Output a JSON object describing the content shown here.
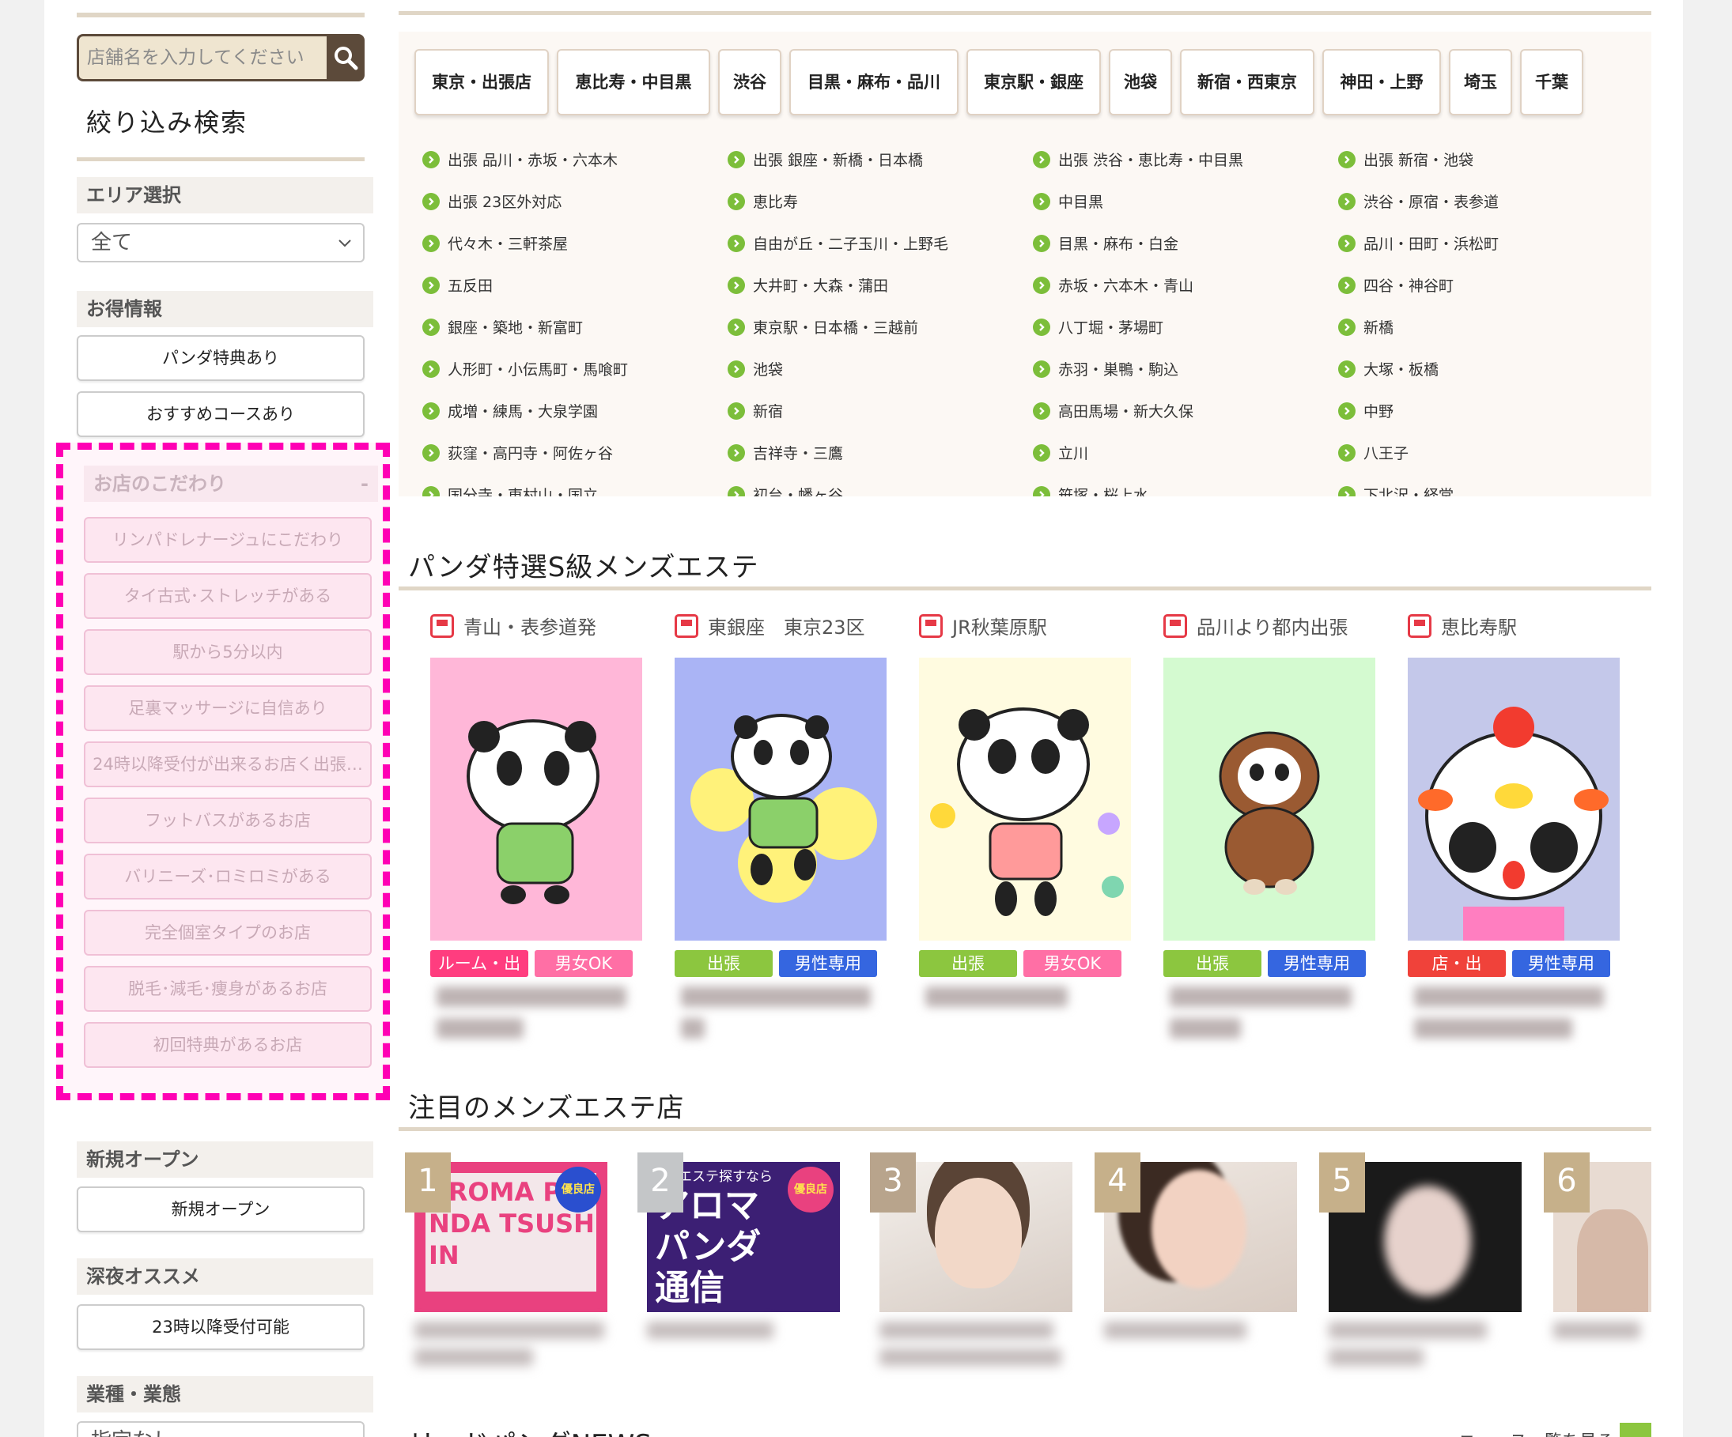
{
  "sidebar": {
    "search_placeholder": "店舗名を入力してください",
    "filter_title": "絞り込み検索",
    "area_head": "エリア選択",
    "area_selected": "全て",
    "deals_head": "お得情報",
    "deal_buttons": [
      "パンダ特典あり",
      "おすすめコースあり"
    ],
    "kodawari_head": "お店のこだわり",
    "kodawari_items": [
      "リンパドレナージュにこだわり",
      "タイ古式･ストレッチがある",
      "駅から5分以内",
      "足裏マッサージに自信あり",
      "24時以降受付が出来るお店く出張…",
      "フットバスがあるお店",
      "バリニーズ･ロミロミがある",
      "完全個室タイプのお店",
      "脱毛･減毛･痩身があるお店",
      "初回特典があるお店"
    ],
    "new_head": "新規オープン",
    "new_button": "新規オープン",
    "late_head": "深夜オススメ",
    "late_button": "23時以降受付可能",
    "type_head": "業種・業態",
    "type_selected": "指定なし"
  },
  "area": {
    "tabs": [
      "東京・出張店",
      "恵比寿・中目黒",
      "渋谷",
      "目黒・麻布・品川",
      "東京駅・銀座",
      "池袋",
      "新宿・西東京",
      "神田・上野",
      "埼玉",
      "千葉"
    ],
    "columns": [
      [
        "出張 品川・赤坂・六本木",
        "出張 23区外対応",
        "代々木・三軒茶屋",
        "五反田",
        "銀座・築地・新富町",
        "人形町・小伝馬町・馬喰町",
        "成増・練馬・大泉学園",
        "荻窪・高円寺・阿佐ヶ谷",
        "国分寺・東村山・国立"
      ],
      [
        "出張 銀座・新橋・日本橋",
        "恵比寿",
        "自由が丘・二子玉川・上野毛",
        "大井町・大森・蒲田",
        "東京駅・日本橋・三越前",
        "池袋",
        "新宿",
        "吉祥寺・三鷹",
        "初台・幡ヶ谷"
      ],
      [
        "出張 渋谷・恵比寿・中目黒",
        "中目黒",
        "目黒・麻布・白金",
        "赤坂・六本木・青山",
        "八丁堀・茅場町",
        "赤羽・巣鴨・駒込",
        "高田馬場・新大久保",
        "立川",
        "笹塚・桜上水"
      ],
      [
        "出張 新宿・池袋",
        "渋谷・原宿・表参道",
        "品川・田町・浜松町",
        "四谷・神谷町",
        "新橋",
        "大塚・板橋",
        "中野",
        "八王子",
        "下北沢・経堂"
      ]
    ]
  },
  "featured": {
    "title": "パンダ特選S級メンズエステ",
    "cards": [
      {
        "loc": "青山・表参道発",
        "tags": [
          {
            "t": "ルーム・出",
            "c": "#ff3d7f"
          },
          {
            "t": "男女OK",
            "c": "#ff6fa5"
          }
        ],
        "bg": "#ffb7d8"
      },
      {
        "loc": "東銀座　東京23区",
        "tags": [
          {
            "t": "出張",
            "c": "#8cc63f"
          },
          {
            "t": "男性専用",
            "c": "#3566e0"
          }
        ],
        "bg": "#aab4f5"
      },
      {
        "loc": "JR秋葉原駅",
        "tags": [
          {
            "t": "出張",
            "c": "#8cc63f"
          },
          {
            "t": "男女OK",
            "c": "#ff6fa5"
          }
        ],
        "bg": "#fffbe0"
      },
      {
        "loc": "品川より都内出張",
        "tags": [
          {
            "t": "出張",
            "c": "#8cc63f"
          },
          {
            "t": "男性専用",
            "c": "#3566e0"
          }
        ],
        "bg": "#d4fad0"
      },
      {
        "loc": "恵比寿駅",
        "tags": [
          {
            "t": "店・出",
            "c": "#f0423a"
          },
          {
            "t": "男性専用",
            "c": "#3566e0"
          }
        ],
        "bg": "#c4c8ea"
      }
    ]
  },
  "attention": {
    "title": "注目のメンズエステ店",
    "ranks": [
      "1",
      "2",
      "3",
      "4",
      "5",
      "6"
    ],
    "thumb1_text": "AROMA PANDA TSUSHIN",
    "thumb2_text": "アロマ パンダ 通信",
    "thumb2_top": "エステ探すなら",
    "badge": "優良店"
  },
  "news": {
    "title": "リードパンダNEWS",
    "more": "ニュース一覧を見る"
  }
}
